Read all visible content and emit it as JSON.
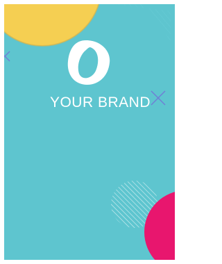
{
  "brand": {
    "name": "YOUR BRAND",
    "logo_icon": "ring-shape-icon"
  },
  "colors": {
    "background": "#5ec5cf",
    "circle_top": "#f5cf52",
    "circle_bottom": "#e8166e",
    "accent_cross": "#6f7fd6",
    "white": "#ffffff"
  }
}
